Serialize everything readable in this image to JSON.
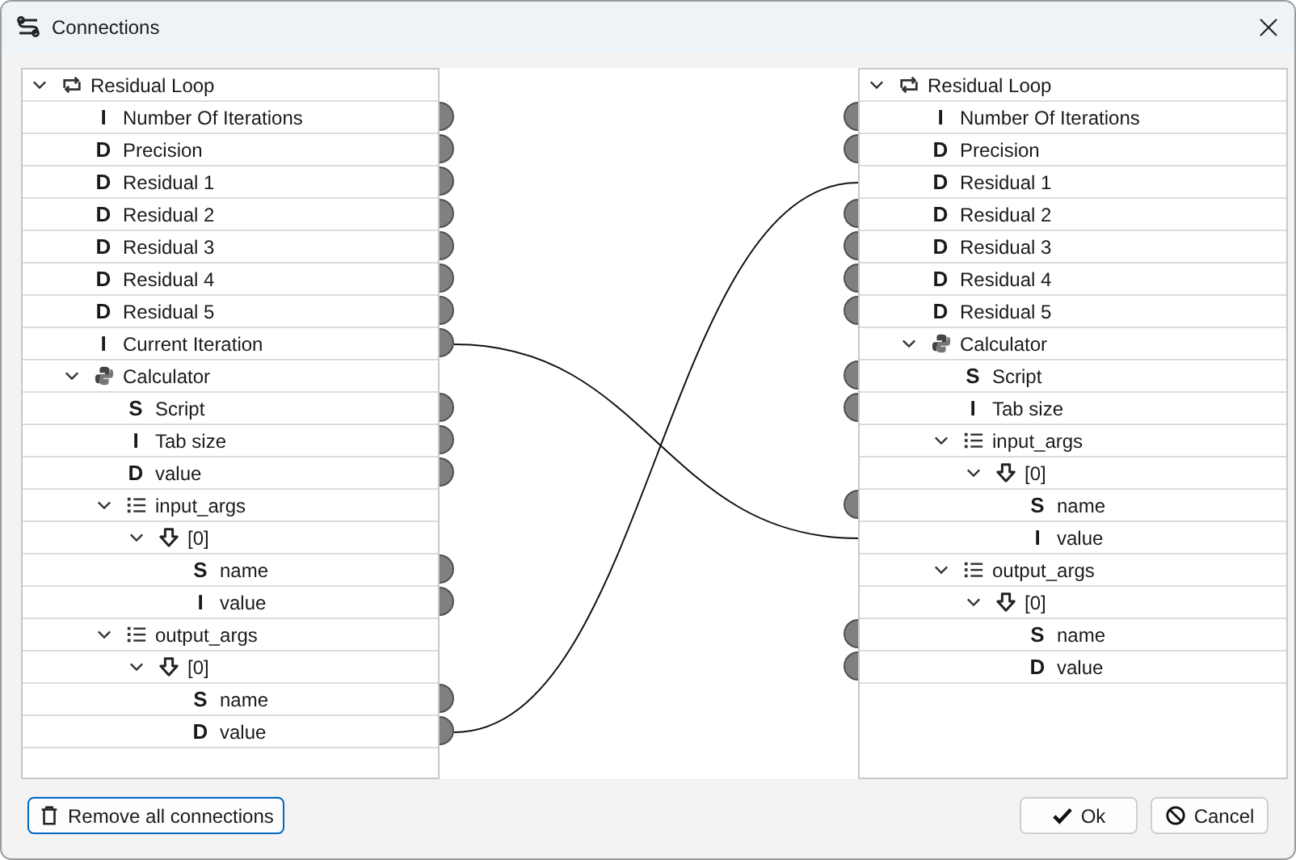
{
  "window": {
    "title": "Connections"
  },
  "left_tree": [
    {
      "label": "Residual Loop",
      "kind": "loop",
      "expanded": true,
      "children": [
        {
          "label": "Number Of Iterations",
          "kind": "field",
          "type": "I",
          "port": true
        },
        {
          "label": "Precision",
          "kind": "field",
          "type": "D",
          "port": true
        },
        {
          "label": "Residual 1",
          "kind": "field",
          "type": "D",
          "port": true
        },
        {
          "label": "Residual 2",
          "kind": "field",
          "type": "D",
          "port": true
        },
        {
          "label": "Residual 3",
          "kind": "field",
          "type": "D",
          "port": true
        },
        {
          "label": "Residual 4",
          "kind": "field",
          "type": "D",
          "port": true
        },
        {
          "label": "Residual 5",
          "kind": "field",
          "type": "D",
          "port": true
        },
        {
          "label": "Current Iteration",
          "kind": "field",
          "type": "I",
          "port": true,
          "connected": true
        },
        {
          "label": "Calculator",
          "kind": "python",
          "expanded": true,
          "children": [
            {
              "label": "Script",
              "kind": "field",
              "type": "S",
              "port": true
            },
            {
              "label": "Tab size",
              "kind": "field",
              "type": "I",
              "port": true
            },
            {
              "label": "value",
              "kind": "field",
              "type": "D",
              "port": true
            },
            {
              "label": "input_args",
              "kind": "list",
              "expanded": true,
              "children": [
                {
                  "label": "[0]",
                  "kind": "item",
                  "expanded": true,
                  "children": [
                    {
                      "label": "name",
                      "kind": "field",
                      "type": "S",
                      "port": true
                    },
                    {
                      "label": "value",
                      "kind": "field",
                      "type": "I",
                      "port": true
                    }
                  ]
                }
              ]
            },
            {
              "label": "output_args",
              "kind": "list",
              "expanded": true,
              "children": [
                {
                  "label": "[0]",
                  "kind": "item",
                  "expanded": true,
                  "children": [
                    {
                      "label": "name",
                      "kind": "field",
                      "type": "S",
                      "port": true
                    },
                    {
                      "label": "value",
                      "kind": "field",
                      "type": "D",
                      "port": true,
                      "connected": true
                    }
                  ]
                }
              ]
            }
          ]
        }
      ]
    }
  ],
  "right_tree": [
    {
      "label": "Residual Loop",
      "kind": "loop",
      "expanded": true,
      "children": [
        {
          "label": "Number Of Iterations",
          "kind": "field",
          "type": "I",
          "port": true
        },
        {
          "label": "Precision",
          "kind": "field",
          "type": "D",
          "port": true
        },
        {
          "label": "Residual 1",
          "kind": "field",
          "type": "D",
          "port": false,
          "connected": true
        },
        {
          "label": "Residual 2",
          "kind": "field",
          "type": "D",
          "port": true
        },
        {
          "label": "Residual 3",
          "kind": "field",
          "type": "D",
          "port": true
        },
        {
          "label": "Residual 4",
          "kind": "field",
          "type": "D",
          "port": true
        },
        {
          "label": "Residual 5",
          "kind": "field",
          "type": "D",
          "port": true
        },
        {
          "label": "Calculator",
          "kind": "python",
          "expanded": true,
          "children": [
            {
              "label": "Script",
              "kind": "field",
              "type": "S",
              "port": true
            },
            {
              "label": "Tab size",
              "kind": "field",
              "type": "I",
              "port": true
            },
            {
              "label": "input_args",
              "kind": "list",
              "expanded": true,
              "children": [
                {
                  "label": "[0]",
                  "kind": "item",
                  "expanded": true,
                  "children": [
                    {
                      "label": "name",
                      "kind": "field",
                      "type": "S",
                      "port": true
                    },
                    {
                      "label": "value",
                      "kind": "field",
                      "type": "I",
                      "port": false,
                      "connected": true
                    }
                  ]
                }
              ]
            },
            {
              "label": "output_args",
              "kind": "list",
              "expanded": true,
              "children": [
                {
                  "label": "[0]",
                  "kind": "item",
                  "expanded": true,
                  "children": [
                    {
                      "label": "name",
                      "kind": "field",
                      "type": "S",
                      "port": true
                    },
                    {
                      "label": "value",
                      "kind": "field",
                      "type": "D",
                      "port": true
                    }
                  ]
                }
              ]
            }
          ]
        }
      ]
    }
  ],
  "buttons": {
    "remove": "Remove all connections",
    "ok": "Ok",
    "cancel": "Cancel"
  }
}
